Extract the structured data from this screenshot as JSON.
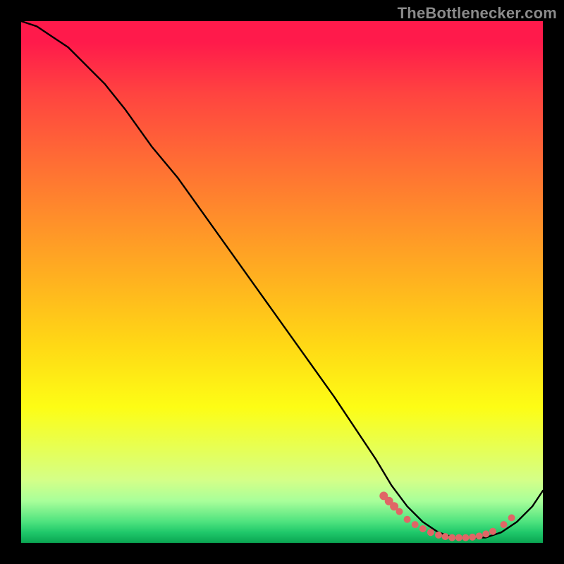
{
  "watermark": "TheBottlenecker.com",
  "colors": {
    "bg": "#000000",
    "curve": "#000000",
    "marker": "#e06666",
    "watermark": "#8a8a8a"
  },
  "chart_data": {
    "type": "line",
    "title": "",
    "xlabel": "",
    "ylabel": "",
    "xlim": [
      0,
      100
    ],
    "ylim": [
      0,
      100
    ],
    "grid": false,
    "legend": false,
    "series": [
      {
        "name": "curve",
        "x": [
          0,
          3,
          6,
          9,
          12,
          16,
          20,
          25,
          30,
          35,
          40,
          45,
          50,
          55,
          60,
          64,
          68,
          71,
          74,
          77,
          80,
          83,
          86,
          89,
          92,
          95,
          98,
          100
        ],
        "y": [
          100,
          99,
          97,
          95,
          92,
          88,
          83,
          76,
          70,
          63,
          56,
          49,
          42,
          35,
          28,
          22,
          16,
          11,
          7,
          4,
          2,
          1,
          1,
          1,
          2,
          4,
          7,
          10
        ]
      }
    ],
    "markers": [
      {
        "x": 69.5,
        "y": 9.0,
        "r": 6
      },
      {
        "x": 70.5,
        "y": 8.0,
        "r": 6
      },
      {
        "x": 71.5,
        "y": 7.0,
        "r": 6
      },
      {
        "x": 72.5,
        "y": 6.0,
        "r": 5
      },
      {
        "x": 74.0,
        "y": 4.5,
        "r": 5
      },
      {
        "x": 75.5,
        "y": 3.5,
        "r": 5
      },
      {
        "x": 77.0,
        "y": 2.7,
        "r": 5
      },
      {
        "x": 78.5,
        "y": 2.0,
        "r": 5
      },
      {
        "x": 80.0,
        "y": 1.5,
        "r": 5
      },
      {
        "x": 81.3,
        "y": 1.2,
        "r": 5
      },
      {
        "x": 82.6,
        "y": 1.0,
        "r": 5
      },
      {
        "x": 83.9,
        "y": 1.0,
        "r": 5
      },
      {
        "x": 85.2,
        "y": 1.0,
        "r": 5
      },
      {
        "x": 86.5,
        "y": 1.1,
        "r": 5
      },
      {
        "x": 87.8,
        "y": 1.3,
        "r": 5
      },
      {
        "x": 89.1,
        "y": 1.7,
        "r": 5
      },
      {
        "x": 90.4,
        "y": 2.2,
        "r": 5
      },
      {
        "x": 92.5,
        "y": 3.5,
        "r": 5
      },
      {
        "x": 94.0,
        "y": 4.8,
        "r": 5
      }
    ]
  }
}
